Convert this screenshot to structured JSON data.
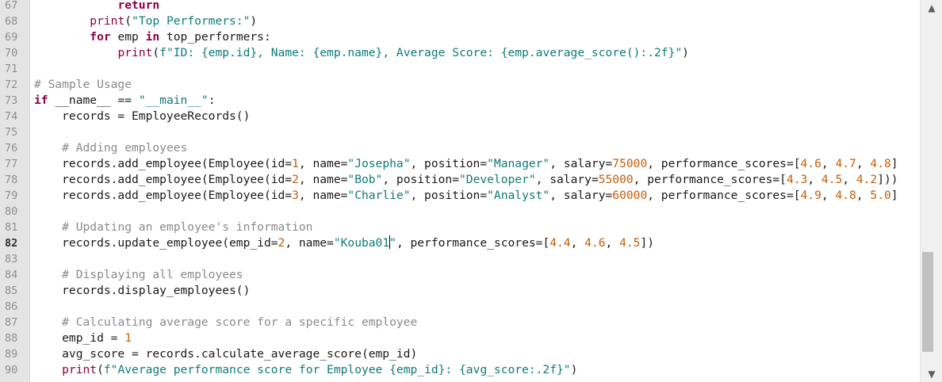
{
  "editor": {
    "active_line": "82",
    "lines": [
      {
        "n": "67",
        "tokens": [
          [
            "",
            "            "
          ],
          [
            "kw",
            "return"
          ]
        ]
      },
      {
        "n": "68",
        "tokens": [
          [
            "",
            "        "
          ],
          [
            "fn",
            "print"
          ],
          [
            "",
            "("
          ],
          [
            "str",
            "\"Top Performers:\""
          ],
          [
            "",
            ")"
          ]
        ]
      },
      {
        "n": "69",
        "tokens": [
          [
            "",
            "        "
          ],
          [
            "kw",
            "for"
          ],
          [
            "",
            " emp "
          ],
          [
            "kw",
            "in"
          ],
          [
            "",
            " top_performers:"
          ]
        ]
      },
      {
        "n": "70",
        "tokens": [
          [
            "",
            "            "
          ],
          [
            "fn",
            "print"
          ],
          [
            "",
            "("
          ],
          [
            "str",
            "f\"ID: {emp.id}, Name: {emp.name}, Average Score: {emp.average_score():.2f}\""
          ],
          [
            "",
            ")"
          ]
        ]
      },
      {
        "n": "71",
        "tokens": []
      },
      {
        "n": "72",
        "tokens": [
          [
            "cm",
            "# Sample Usage"
          ]
        ]
      },
      {
        "n": "73",
        "tokens": [
          [
            "kw",
            "if"
          ],
          [
            "",
            " __name__ == "
          ],
          [
            "str",
            "\"__main__\""
          ],
          [
            "",
            ":"
          ]
        ]
      },
      {
        "n": "74",
        "tokens": [
          [
            "",
            "    records = EmployeeRecords()"
          ]
        ]
      },
      {
        "n": "75",
        "tokens": []
      },
      {
        "n": "76",
        "tokens": [
          [
            "",
            "    "
          ],
          [
            "cm",
            "# Adding employees"
          ]
        ]
      },
      {
        "n": "77",
        "tokens": [
          [
            "",
            "    records.add_employee(Employee(id="
          ],
          [
            "num",
            "1"
          ],
          [
            "",
            ", name="
          ],
          [
            "str",
            "\"Josepha\""
          ],
          [
            "",
            ", position="
          ],
          [
            "str",
            "\"Manager\""
          ],
          [
            "",
            ", salary="
          ],
          [
            "num",
            "75000"
          ],
          [
            "",
            ", performance_scores=["
          ],
          [
            "num",
            "4.6"
          ],
          [
            "",
            ", "
          ],
          [
            "num",
            "4.7"
          ],
          [
            "",
            ", "
          ],
          [
            "num",
            "4.8"
          ],
          [
            "",
            "]"
          ]
        ]
      },
      {
        "n": "78",
        "tokens": [
          [
            "",
            "    records.add_employee(Employee(id="
          ],
          [
            "num",
            "2"
          ],
          [
            "",
            ", name="
          ],
          [
            "str",
            "\"Bob\""
          ],
          [
            "",
            ", position="
          ],
          [
            "str",
            "\"Developer\""
          ],
          [
            "",
            ", salary="
          ],
          [
            "num",
            "55000"
          ],
          [
            "",
            ", performance_scores=["
          ],
          [
            "num",
            "4.3"
          ],
          [
            "",
            ", "
          ],
          [
            "num",
            "4.5"
          ],
          [
            "",
            ", "
          ],
          [
            "num",
            "4.2"
          ],
          [
            "",
            "]))"
          ]
        ]
      },
      {
        "n": "79",
        "tokens": [
          [
            "",
            "    records.add_employee(Employee(id="
          ],
          [
            "num",
            "3"
          ],
          [
            "",
            ", name="
          ],
          [
            "str",
            "\"Charlie\""
          ],
          [
            "",
            ", position="
          ],
          [
            "str",
            "\"Analyst\""
          ],
          [
            "",
            ", salary="
          ],
          [
            "num",
            "60000"
          ],
          [
            "",
            ", performance_scores=["
          ],
          [
            "num",
            "4.9"
          ],
          [
            "",
            ", "
          ],
          [
            "num",
            "4.8"
          ],
          [
            "",
            ", "
          ],
          [
            "num",
            "5.0"
          ],
          [
            "",
            "]"
          ]
        ]
      },
      {
        "n": "80",
        "tokens": []
      },
      {
        "n": "81",
        "tokens": [
          [
            "",
            "    "
          ],
          [
            "cm",
            "# Updating an employee's information"
          ]
        ]
      },
      {
        "n": "82",
        "tokens": [
          [
            "",
            "    records.update_employee(emp_id="
          ],
          [
            "num",
            "2"
          ],
          [
            "",
            ", name="
          ],
          [
            "str",
            "\"Kouba01"
          ],
          [
            "caret",
            ""
          ],
          [
            "str",
            "\""
          ],
          [
            "",
            ", performance_scores=["
          ],
          [
            "num",
            "4.4"
          ],
          [
            "",
            ", "
          ],
          [
            "num",
            "4.6"
          ],
          [
            "",
            ", "
          ],
          [
            "num",
            "4.5"
          ],
          [
            "",
            "])"
          ]
        ]
      },
      {
        "n": "83",
        "tokens": []
      },
      {
        "n": "84",
        "tokens": [
          [
            "",
            "    "
          ],
          [
            "cm",
            "# Displaying all employees"
          ]
        ]
      },
      {
        "n": "85",
        "tokens": [
          [
            "",
            "    records.display_employees()"
          ]
        ]
      },
      {
        "n": "86",
        "tokens": []
      },
      {
        "n": "87",
        "tokens": [
          [
            "",
            "    "
          ],
          [
            "cm",
            "# Calculating average score for a specific employee"
          ]
        ]
      },
      {
        "n": "88",
        "tokens": [
          [
            "",
            "    emp_id = "
          ],
          [
            "num",
            "1"
          ]
        ]
      },
      {
        "n": "89",
        "tokens": [
          [
            "",
            "    avg_score = records.calculate_average_score(emp_id)"
          ]
        ]
      },
      {
        "n": "90",
        "tokens": [
          [
            "",
            "    "
          ],
          [
            "fn",
            "print"
          ],
          [
            "",
            "("
          ],
          [
            "str",
            "f\"Average performance score for Employee {emp_id}: {avg_score:.2f}\""
          ],
          [
            "",
            ")"
          ]
        ]
      }
    ]
  },
  "scrollbar": {
    "up_icon": "▲",
    "down_icon": "▼",
    "thumb_start_fraction": 0.675,
    "thumb_fraction": 0.285
  }
}
